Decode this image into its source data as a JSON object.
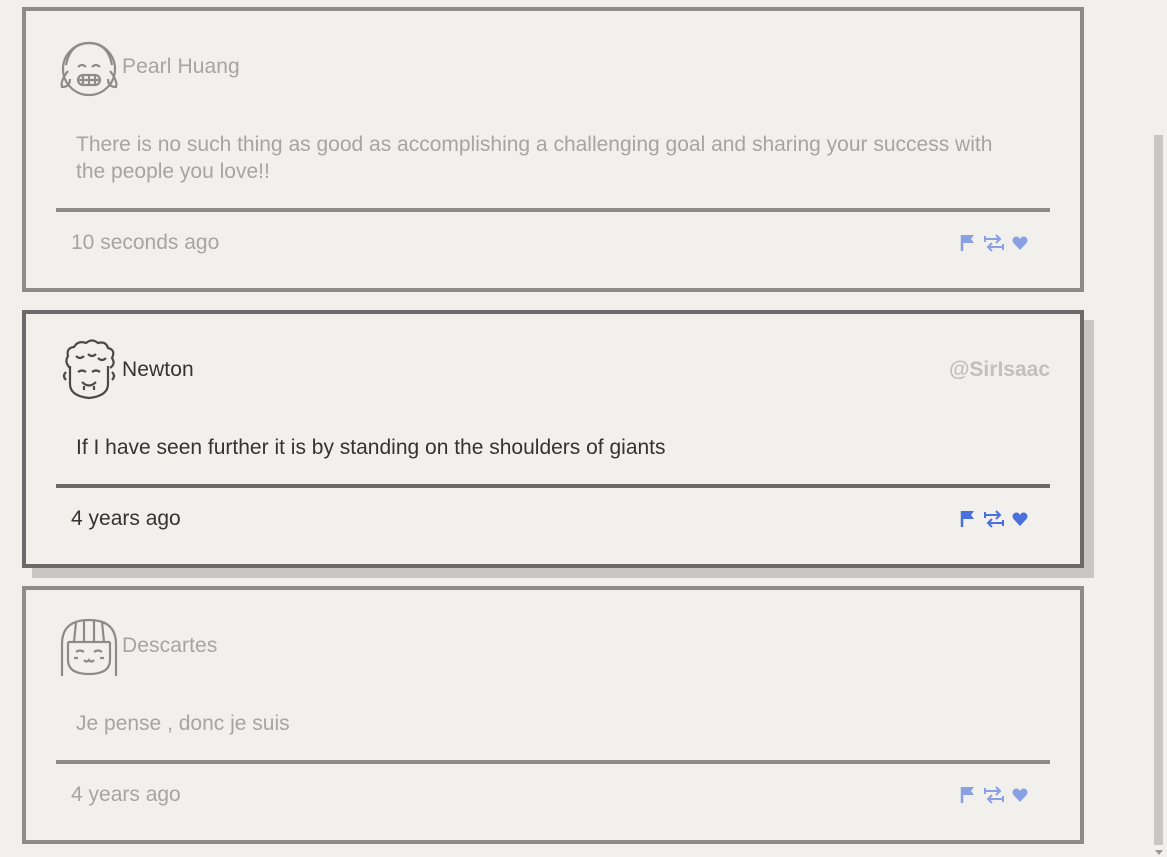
{
  "posts": [
    {
      "author": "Pearl Huang",
      "handle": "",
      "text": "There is no such thing as good as accomplishing a challenging goal and sharing your success with the people you love!!",
      "time": "10 seconds ago",
      "avatar_icon": "girl-pigtails-avatar-icon"
    },
    {
      "author": "Newton",
      "handle": "@SirIsaac",
      "text": "If I have seen further it is by standing on the shoulders of giants",
      "time": "4 years ago",
      "avatar_icon": "curly-hair-avatar-icon"
    },
    {
      "author": "Descartes",
      "handle": "",
      "text": "Je pense , donc je suis",
      "time": "4 years ago",
      "avatar_icon": "bob-hair-avatar-icon"
    }
  ],
  "actions": {
    "flag_icon": "flag-icon",
    "retweet_icon": "retweet-icon",
    "like_icon": "heart-icon"
  },
  "colors": {
    "background": "#f2f0ec",
    "border_faded": "#8f8b88",
    "border_active": "#6a6a6a",
    "action_blue": "#4a6fde"
  }
}
